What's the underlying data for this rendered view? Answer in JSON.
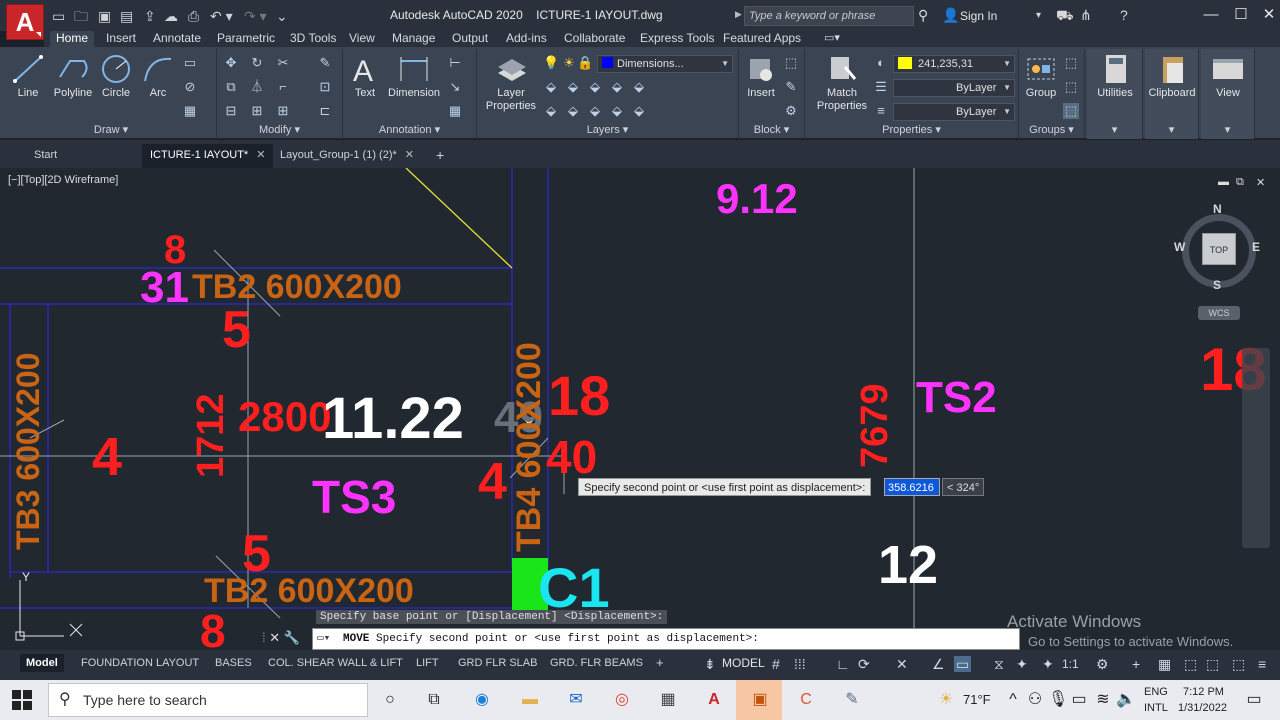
{
  "titlebar": {
    "app_name": "Autodesk AutoCAD 2020",
    "file_name": "ICTURE-1 IAYOUT.dwg",
    "search_placeholder": "Type a keyword or phrase",
    "signin_label": "Sign In"
  },
  "ribbon_tabs": [
    "Home",
    "Insert",
    "Annotate",
    "Parametric",
    "3D Tools",
    "View",
    "Manage",
    "Output",
    "Add-ins",
    "Collaborate",
    "Express Tools",
    "Featured Apps"
  ],
  "ribbon": {
    "draw": {
      "title": "Draw",
      "line": "Line",
      "polyline": "Polyline",
      "circle": "Circle",
      "arc": "Arc"
    },
    "modify": {
      "title": "Modify"
    },
    "annotation": {
      "title": "Annotation",
      "text": "Text",
      "dimension": "Dimension"
    },
    "layers": {
      "title": "Layers",
      "layer_properties_1": "Layer",
      "layer_properties_2": "Properties",
      "current_layer": "Dimensions..."
    },
    "block": {
      "title": "Block",
      "insert": "Insert"
    },
    "properties": {
      "title": "Properties",
      "match_1": "Match",
      "match_2": "Properties",
      "color": "241,235,31",
      "linetype": "ByLayer",
      "lineweight": "ByLayer"
    },
    "groups": {
      "title": "Groups",
      "group": "Group"
    },
    "utilities": "Utilities",
    "clipboard": "Clipboard",
    "view": "View"
  },
  "file_tabs": {
    "start": "Start",
    "doc1": "ICTURE-1 IAYOUT*",
    "doc2": "Layout_Group-1 (1) (2)*"
  },
  "viewport_label": "[−][Top][2D Wireframe]",
  "drawing_text": {
    "t_912": "9.12",
    "t_8_top": "8",
    "t_31": "31",
    "t_tb2_top": "TB2 600X200",
    "t_5_top": "5",
    "t_tb3": "TB3 600X200",
    "t_4_left": "4",
    "t_1712": "1712",
    "t_2800": "2800",
    "t_1122": "11.22",
    "t_49": "49",
    "t_18": "18",
    "t_40": "40",
    "t_ts3": "TS3",
    "t_4_mid": "4",
    "t_tb4": "TB4 600X200",
    "t_5_bot": "5",
    "t_tb2_bot": "TB2 600X200",
    "t_8_bot": "8",
    "t_c1": "C1",
    "t_7679": "7679",
    "t_ts2": "TS2",
    "t_12": "12",
    "t_18_right": "18"
  },
  "cursor_tip": {
    "prompt": "Specify second point or <use first point as displacement>:",
    "distance": "358.6216",
    "angle": "< 324°"
  },
  "command": {
    "history": "Specify base point or [Displacement] <Displacement>:",
    "command_name": "MOVE",
    "current_prompt": "Specify second point or <use first point as displacement>:"
  },
  "viewcube": {
    "n": "N",
    "s": "S",
    "e": "E",
    "w": "W",
    "top": "TOP",
    "wcs": "WCS"
  },
  "axis": {
    "y": "Y"
  },
  "watermark": {
    "line1": "Activate Windows",
    "line2": "Go to Settings to activate Windows."
  },
  "layout_tabs": [
    "Model",
    "FOUNDATION LAYOUT",
    "BASES",
    "COL. SHEAR WALL & LIFT",
    "LIFT",
    "GRD FLR SLAB",
    "GRD. FLR BEAMS"
  ],
  "status": {
    "model": "MODEL",
    "scale": "1:1"
  },
  "taskbar": {
    "search_placeholder": "Type here to search",
    "temperature": "71°F",
    "lang1": "ENG",
    "lang2": "INTL",
    "time": "7:12 PM",
    "date": "1/31/2022"
  },
  "colors": {
    "canvas_bg": "#212830",
    "red_text": "#ff1f1f",
    "magenta_text": "#ff33ff",
    "orange_text": "#c86414",
    "cyan_text": "#19e6f0",
    "selected_color": "#ffff00",
    "layer_color": "#0000ff",
    "column_fill": "#19e619",
    "blue_lines": "#2222cc"
  }
}
